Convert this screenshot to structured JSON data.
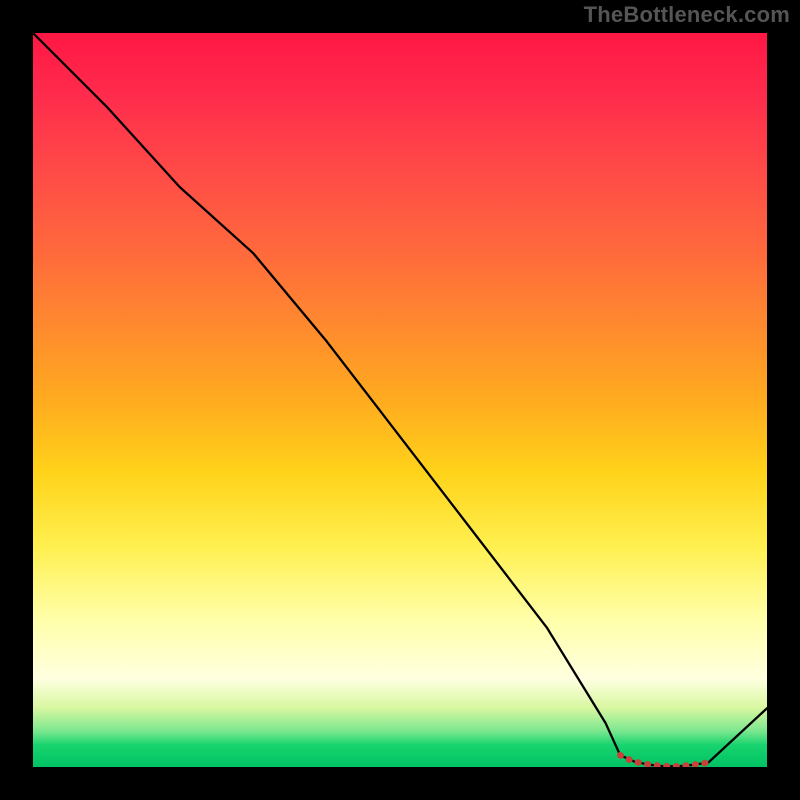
{
  "watermark": "TheBottleneck.com",
  "chart_data": {
    "type": "line",
    "title": "",
    "xlabel": "",
    "ylabel": "",
    "xlim": [
      0,
      100
    ],
    "ylim": [
      0,
      100
    ],
    "series": [
      {
        "name": "curve",
        "x": [
          0,
          10,
          20,
          30,
          40,
          50,
          60,
          70,
          78,
          80,
          82,
          84,
          86,
          88,
          90,
          92,
          100
        ],
        "y": [
          100,
          90,
          79,
          70,
          58,
          45,
          32,
          19,
          6,
          1.6,
          0.7,
          0.3,
          0.1,
          0.1,
          0.3,
          0.6,
          8
        ]
      },
      {
        "name": "markers",
        "x": [
          80,
          81,
          82,
          83,
          84,
          85,
          86,
          87,
          88,
          89,
          90,
          91,
          92
        ],
        "y": [
          1.6,
          1.1,
          0.7,
          0.5,
          0.3,
          0.2,
          0.1,
          0.1,
          0.1,
          0.2,
          0.3,
          0.45,
          0.6
        ]
      }
    ],
    "colors": {
      "curve": "#000000",
      "markers": "#c7433a"
    }
  }
}
